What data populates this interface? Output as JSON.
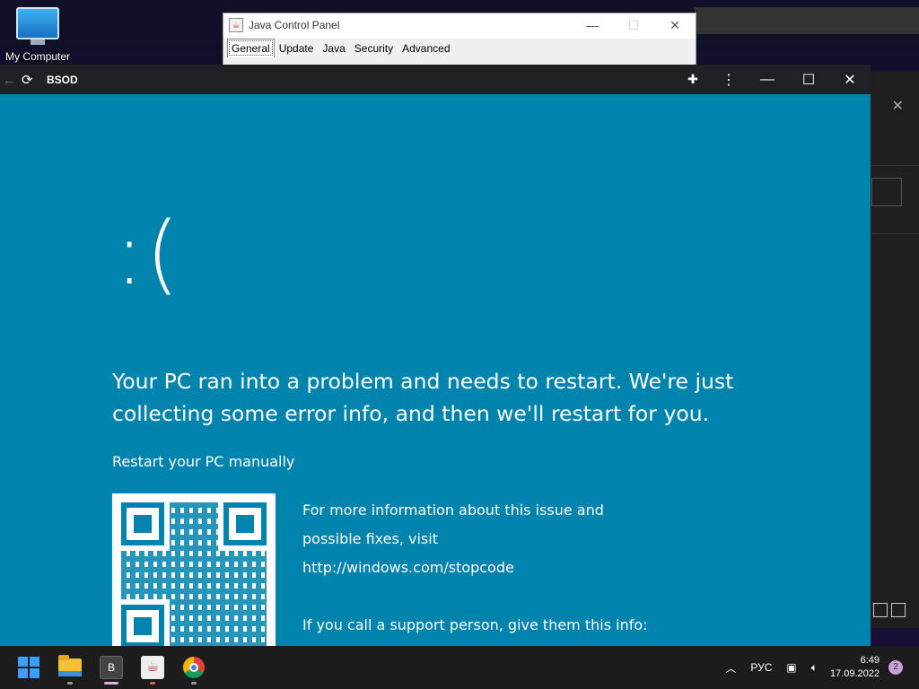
{
  "desktop": {
    "icon_label": "My Computer"
  },
  "java_panel": {
    "title": "Java Control Panel",
    "tabs": [
      "General",
      "Update",
      "Java",
      "Security",
      "Advanced"
    ]
  },
  "browser": {
    "tab_title": "BSOD",
    "minimize": "—",
    "maximize": "☐",
    "close": "✕"
  },
  "bsod": {
    "face": ":(",
    "message": "Your PC ran into a problem and needs to restart. We're just collecting some error info, and then we'll restart for you.",
    "restart_text": "Restart your PC manually",
    "info_line1": "For more information about this issue and",
    "info_line2": "possible fixes, visit",
    "info_url": "http://windows.com/stopcode",
    "support_text": "If you call a support person, give them this info:"
  },
  "taskbar": {
    "language": "РУС",
    "time": "6:49",
    "date": "17.09.2022",
    "notifications": "2",
    "b_app_label": "B"
  },
  "colors": {
    "bsod_bg": "#0083ad",
    "taskbar_bg": "#1c1c1c"
  }
}
